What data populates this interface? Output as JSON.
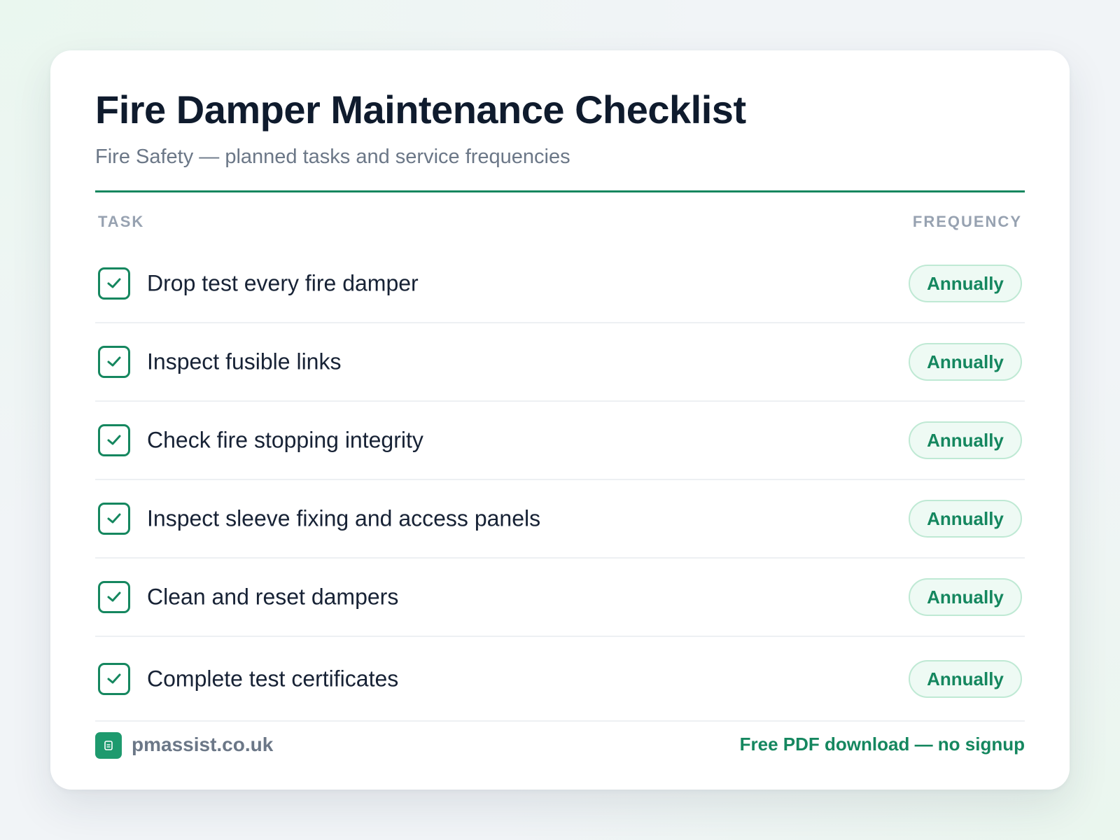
{
  "header": {
    "title": "Fire Damper Maintenance Checklist",
    "subtitle": "Fire Safety — planned tasks and service frequencies"
  },
  "table": {
    "columns": {
      "task": "TASK",
      "frequency": "FREQUENCY"
    },
    "rows": [
      {
        "task": "Drop test every fire damper",
        "frequency": "Annually",
        "checked": true
      },
      {
        "task": "Inspect fusible links",
        "frequency": "Annually",
        "checked": true
      },
      {
        "task": "Check fire stopping integrity",
        "frequency": "Annually",
        "checked": true
      },
      {
        "task": "Inspect sleeve fixing and access panels",
        "frequency": "Annually",
        "checked": true
      },
      {
        "task": "Clean and reset dampers",
        "frequency": "Annually",
        "checked": true
      },
      {
        "task": "Complete test certificates",
        "frequency": "Annually",
        "checked": true
      }
    ]
  },
  "footer": {
    "logo_icon": "document-icon",
    "site": "pmassist.co.uk",
    "cta": "Free PDF download — no signup"
  },
  "colors": {
    "accent": "#15875f",
    "title": "#0f1b2d",
    "muted": "#6b7787",
    "badge_bg": "#eefaf4",
    "badge_border": "#bfe9d4"
  }
}
